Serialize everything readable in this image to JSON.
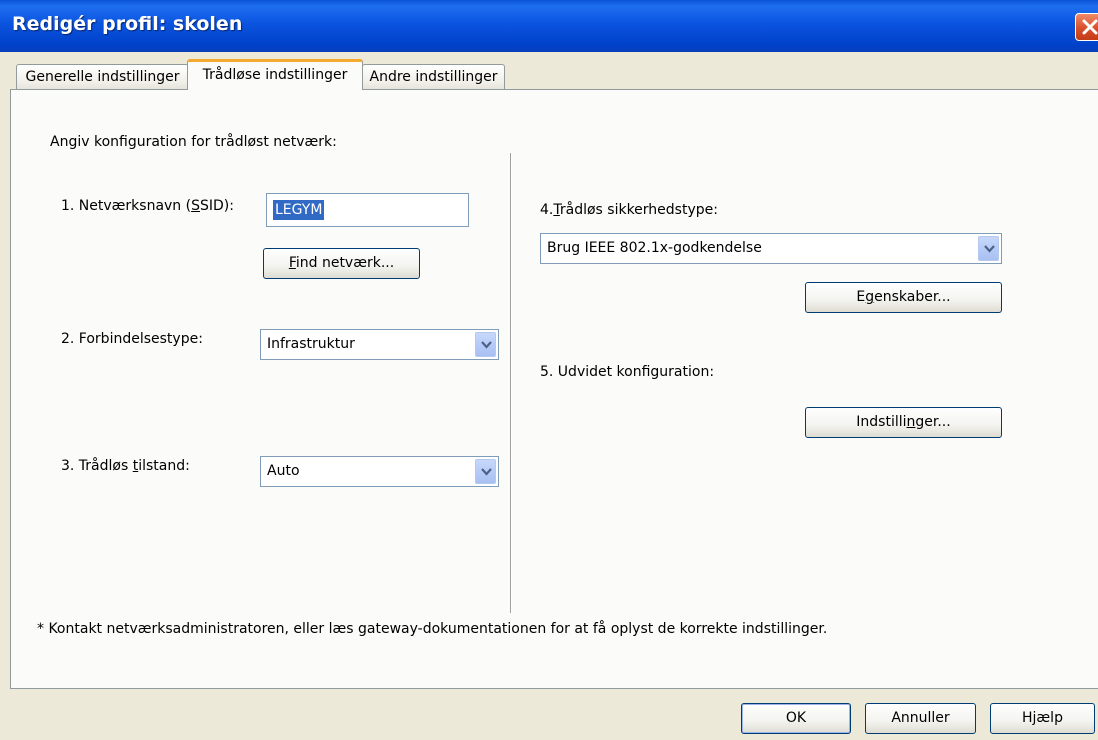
{
  "window": {
    "title": "Redigér profil: skolen"
  },
  "tabs": [
    {
      "label": "Generelle indstillinger"
    },
    {
      "label": "Trådløse indstillinger"
    },
    {
      "label": "Andre indstillinger"
    }
  ],
  "form": {
    "intro": "Angiv konfiguration for trådløst netværk:",
    "ssid": {
      "label_pre": "1. Netværksnavn (",
      "label_ul": "S",
      "label_post": "SID):",
      "value": "LEGYM"
    },
    "find_button": {
      "ul": "F",
      "rest": "ind netværk..."
    },
    "connection": {
      "label": "2. Forbindelsestype:",
      "value": "Infrastruktur"
    },
    "mode": {
      "label_pre": "3. Trådløs ",
      "label_ul": "t",
      "label_post": "ilstand:",
      "value": "Auto"
    },
    "security": {
      "label_pre": "4.",
      "label_ul": "T",
      "label_post": "rådløs sikkerhedstype:",
      "value": "Brug IEEE 802.1x-godkendelse"
    },
    "properties_button": {
      "pre": "E",
      "ul": "g",
      "post": "enskaber..."
    },
    "advanced": {
      "label": "5. Udvidet konfiguration:"
    },
    "settings_button": {
      "pre": "Indstilli",
      "ul": "n",
      "post": "ger..."
    },
    "footnote": "* Kontakt netværksadministratoren, eller læs gateway-dokumentationen for at få oplyst de korrekte indstillinger."
  },
  "buttons": {
    "ok": "OK",
    "cancel": "Annuller",
    "help": "Hjælp"
  },
  "colors": {
    "titlebar": "#0b54e0",
    "tab_accent": "#f4a930",
    "selection": "#316ac5",
    "face": "#ece9d8"
  }
}
